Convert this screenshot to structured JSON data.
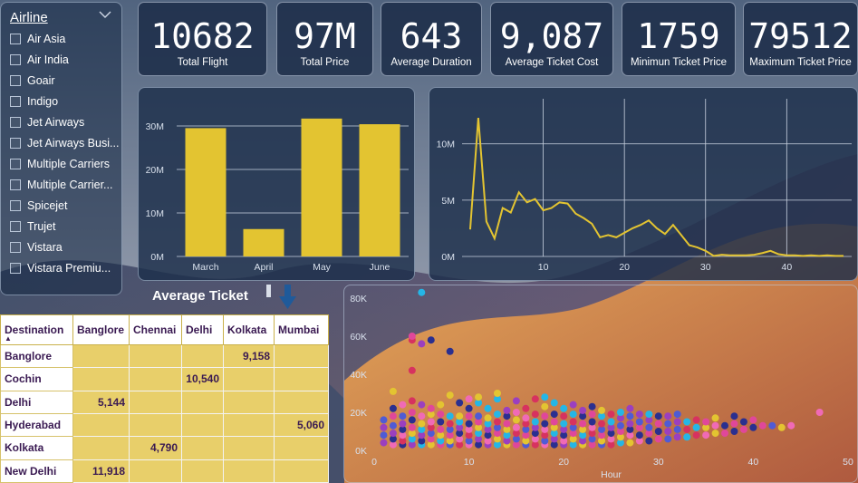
{
  "colors": {
    "bar": "#e3c431",
    "line": "#e3c431",
    "panel": "#1c2e4a",
    "scatter": [
      "#e0479a",
      "#f06ab6",
      "#25b6e6",
      "#4f5bd5",
      "#2a2f8f",
      "#e3c431",
      "#d7325f",
      "#9b3fbf"
    ]
  },
  "slicer": {
    "title": "Airline",
    "chevron_icon": "chevron-down-icon",
    "items": [
      "Air Asia",
      "Air India",
      "Goair",
      "Indigo",
      "Jet Airways",
      "Jet Airways Busi...",
      "Multiple Carriers",
      "Multiple Carrier...",
      "Spicejet",
      "Trujet",
      "Vistara",
      "Vistara Premiu..."
    ]
  },
  "kpis": [
    {
      "value": "10682",
      "label": "Total Flight"
    },
    {
      "value": "97M",
      "label": "Total Price"
    },
    {
      "value": "643",
      "label": "Average Duration"
    },
    {
      "value": "9,087",
      "label": "Average Ticket Cost"
    },
    {
      "value": "1759",
      "label": "Minimun Ticket Price"
    },
    {
      "value": "79512",
      "label": "Maximum Ticket Price"
    }
  ],
  "table": {
    "title": "Average Ticket",
    "sort_icon": "arrow-down-icon",
    "headers": [
      "Destination",
      "Banglore",
      "Chennai",
      "Delhi",
      "Kolkata",
      "Mumbai"
    ],
    "rows": [
      {
        "name": "Banglore",
        "cells": [
          "",
          "",
          "",
          "9,158",
          ""
        ]
      },
      {
        "name": "Cochin",
        "cells": [
          "",
          "",
          "10,540",
          "",
          ""
        ]
      },
      {
        "name": "Delhi",
        "cells": [
          "5,144",
          "",
          "",
          "",
          ""
        ]
      },
      {
        "name": "Hyderabad",
        "cells": [
          "",
          "",
          "",
          "",
          "5,060"
        ]
      },
      {
        "name": "Kolkata",
        "cells": [
          "",
          "4,790",
          "",
          "",
          ""
        ]
      },
      {
        "name": "New Delhi",
        "cells": [
          "11,918",
          "",
          "",
          "",
          ""
        ]
      }
    ]
  },
  "chart_data": [
    {
      "type": "bar",
      "categories": [
        "March",
        "April",
        "May",
        "June"
      ],
      "values": [
        29.5,
        6.3,
        31.7,
        30.4
      ],
      "ylim": [
        0,
        35
      ],
      "yticks": [
        "0M",
        "10M",
        "20M",
        "30M"
      ],
      "ytick_values": [
        0,
        10,
        20,
        30
      ],
      "grid": true
    },
    {
      "type": "line",
      "x": [
        1,
        2,
        3,
        4,
        5,
        6,
        7,
        8,
        9,
        10,
        11,
        12,
        13,
        14,
        15,
        16,
        17,
        18,
        19,
        20,
        21,
        22,
        23,
        24,
        25,
        26,
        27,
        28,
        29,
        30,
        31,
        32,
        33,
        34,
        35,
        36,
        37,
        38,
        39,
        40,
        41,
        42,
        43,
        44,
        45,
        46,
        47
      ],
      "values": [
        2.4,
        12.3,
        3.1,
        1.6,
        4.3,
        3.9,
        5.7,
        4.8,
        5.1,
        4.1,
        4.3,
        4.8,
        4.7,
        3.8,
        3.4,
        2.9,
        1.7,
        1.9,
        1.7,
        2.1,
        2.5,
        2.8,
        3.2,
        2.5,
        2.0,
        2.8,
        1.9,
        1.0,
        0.8,
        0.5,
        0.05,
        0.15,
        0.1,
        0.1,
        0.1,
        0.15,
        0.3,
        0.5,
        0.2,
        0.1,
        0.1,
        0.05,
        0.1,
        0.05,
        0.1,
        0.05,
        0.05
      ],
      "xlim": [
        0,
        48
      ],
      "ylim": [
        0,
        14
      ],
      "xticks": [
        "10",
        "20",
        "30",
        "40"
      ],
      "xtick_values": [
        10,
        20,
        30,
        40
      ],
      "yticks": [
        "0M",
        "5M",
        "10M"
      ],
      "ytick_values": [
        0,
        5,
        10
      ],
      "grid": true
    },
    {
      "type": "scatter",
      "xlabel": "Hour",
      "xlim": [
        0,
        50
      ],
      "ylim": [
        0,
        80
      ],
      "xticks": [
        "0",
        "10",
        "20",
        "30",
        "40",
        "50"
      ],
      "xtick_values": [
        0,
        10,
        20,
        30,
        40,
        50
      ],
      "yticks": [
        "0K",
        "20K",
        "40K",
        "60K",
        "80K"
      ],
      "ytick_values": [
        0,
        20,
        40,
        60,
        80
      ],
      "points": [
        [
          1,
          4
        ],
        [
          1,
          8
        ],
        [
          1,
          12
        ],
        [
          1,
          16
        ],
        [
          2,
          3
        ],
        [
          2,
          6
        ],
        [
          2,
          9
        ],
        [
          2,
          13
        ],
        [
          2,
          18
        ],
        [
          2,
          22
        ],
        [
          2,
          31
        ],
        [
          3,
          3
        ],
        [
          3,
          5
        ],
        [
          3,
          8
        ],
        [
          3,
          11
        ],
        [
          3,
          14
        ],
        [
          3,
          18
        ],
        [
          3,
          24
        ],
        [
          4,
          3
        ],
        [
          4,
          6
        ],
        [
          4,
          9
        ],
        [
          4,
          12
        ],
        [
          4,
          16
        ],
        [
          4,
          20
        ],
        [
          4,
          26
        ],
        [
          4,
          42
        ],
        [
          4,
          58
        ],
        [
          4,
          60
        ],
        [
          5,
          3
        ],
        [
          5,
          5
        ],
        [
          5,
          8
        ],
        [
          5,
          11
        ],
        [
          5,
          14
        ],
        [
          5,
          18
        ],
        [
          5,
          24
        ],
        [
          5,
          56
        ],
        [
          5,
          83
        ],
        [
          6,
          3
        ],
        [
          6,
          6
        ],
        [
          6,
          9
        ],
        [
          6,
          12
        ],
        [
          6,
          15
        ],
        [
          6,
          19
        ],
        [
          6,
          22
        ],
        [
          6,
          58
        ],
        [
          7,
          3
        ],
        [
          7,
          5
        ],
        [
          7,
          8
        ],
        [
          7,
          11
        ],
        [
          7,
          15
        ],
        [
          7,
          19
        ],
        [
          7,
          24
        ],
        [
          8,
          3
        ],
        [
          8,
          5
        ],
        [
          8,
          8
        ],
        [
          8,
          11
        ],
        [
          8,
          14
        ],
        [
          8,
          18
        ],
        [
          8,
          29
        ],
        [
          8,
          52
        ],
        [
          9,
          3
        ],
        [
          9,
          6
        ],
        [
          9,
          9
        ],
        [
          9,
          12
        ],
        [
          9,
          15
        ],
        [
          9,
          18
        ],
        [
          9,
          25
        ],
        [
          10,
          3
        ],
        [
          10,
          5
        ],
        [
          10,
          8
        ],
        [
          10,
          11
        ],
        [
          10,
          14
        ],
        [
          10,
          18
        ],
        [
          10,
          22
        ],
        [
          10,
          27
        ],
        [
          11,
          3
        ],
        [
          11,
          6
        ],
        [
          11,
          9
        ],
        [
          11,
          12
        ],
        [
          11,
          15
        ],
        [
          11,
          18
        ],
        [
          11,
          25
        ],
        [
          11,
          28
        ],
        [
          12,
          3
        ],
        [
          12,
          5
        ],
        [
          12,
          8
        ],
        [
          12,
          11
        ],
        [
          12,
          14
        ],
        [
          12,
          17
        ],
        [
          12,
          22
        ],
        [
          13,
          3
        ],
        [
          13,
          6
        ],
        [
          13,
          9
        ],
        [
          13,
          12
        ],
        [
          13,
          15
        ],
        [
          13,
          19
        ],
        [
          13,
          27
        ],
        [
          13,
          30
        ],
        [
          14,
          3
        ],
        [
          14,
          5
        ],
        [
          14,
          8
        ],
        [
          14,
          11
        ],
        [
          14,
          14
        ],
        [
          14,
          18
        ],
        [
          14,
          21
        ],
        [
          15,
          3
        ],
        [
          15,
          6
        ],
        [
          15,
          9
        ],
        [
          15,
          12
        ],
        [
          15,
          16
        ],
        [
          15,
          20
        ],
        [
          15,
          26
        ],
        [
          16,
          3
        ],
        [
          16,
          5
        ],
        [
          16,
          8
        ],
        [
          16,
          11
        ],
        [
          16,
          14
        ],
        [
          16,
          17
        ],
        [
          16,
          22
        ],
        [
          17,
          3
        ],
        [
          17,
          6
        ],
        [
          17,
          9
        ],
        [
          17,
          12
        ],
        [
          17,
          15
        ],
        [
          17,
          19
        ],
        [
          17,
          27
        ],
        [
          18,
          3
        ],
        [
          18,
          5
        ],
        [
          18,
          8
        ],
        [
          18,
          11
        ],
        [
          18,
          14
        ],
        [
          18,
          18
        ],
        [
          18,
          23
        ],
        [
          18,
          28
        ],
        [
          19,
          3
        ],
        [
          19,
          6
        ],
        [
          19,
          9
        ],
        [
          19,
          12
        ],
        [
          19,
          15
        ],
        [
          19,
          19
        ],
        [
          19,
          25
        ],
        [
          20,
          3
        ],
        [
          20,
          5
        ],
        [
          20,
          8
        ],
        [
          20,
          11
        ],
        [
          20,
          14
        ],
        [
          20,
          18
        ],
        [
          20,
          22
        ],
        [
          21,
          3
        ],
        [
          21,
          6
        ],
        [
          21,
          9
        ],
        [
          21,
          12
        ],
        [
          21,
          15
        ],
        [
          21,
          19
        ],
        [
          21,
          24
        ],
        [
          22,
          3
        ],
        [
          22,
          5
        ],
        [
          22,
          8
        ],
        [
          22,
          11
        ],
        [
          22,
          14
        ],
        [
          22,
          18
        ],
        [
          22,
          21
        ],
        [
          23,
          3
        ],
        [
          23,
          6
        ],
        [
          23,
          9
        ],
        [
          23,
          12
        ],
        [
          23,
          15
        ],
        [
          23,
          19
        ],
        [
          23,
          23
        ],
        [
          24,
          3
        ],
        [
          24,
          5
        ],
        [
          24,
          8
        ],
        [
          24,
          11
        ],
        [
          24,
          14
        ],
        [
          24,
          18
        ],
        [
          24,
          21
        ],
        [
          25,
          3
        ],
        [
          25,
          6
        ],
        [
          25,
          9
        ],
        [
          25,
          12
        ],
        [
          25,
          15
        ],
        [
          25,
          19
        ],
        [
          26,
          4
        ],
        [
          26,
          7
        ],
        [
          26,
          10
        ],
        [
          26,
          13
        ],
        [
          26,
          17
        ],
        [
          26,
          20
        ],
        [
          27,
          4
        ],
        [
          27,
          8
        ],
        [
          27,
          11
        ],
        [
          27,
          14
        ],
        [
          27,
          18
        ],
        [
          27,
          22
        ],
        [
          28,
          5
        ],
        [
          28,
          8
        ],
        [
          28,
          12
        ],
        [
          28,
          15
        ],
        [
          28,
          19
        ],
        [
          29,
          5
        ],
        [
          29,
          9
        ],
        [
          29,
          12
        ],
        [
          29,
          16
        ],
        [
          29,
          19
        ],
        [
          30,
          6
        ],
        [
          30,
          10
        ],
        [
          30,
          14
        ],
        [
          30,
          18
        ],
        [
          31,
          6
        ],
        [
          31,
          10
        ],
        [
          31,
          14
        ],
        [
          31,
          18
        ],
        [
          32,
          7
        ],
        [
          32,
          11
        ],
        [
          32,
          15
        ],
        [
          32,
          19
        ],
        [
          33,
          7
        ],
        [
          33,
          11
        ],
        [
          33,
          15
        ],
        [
          34,
          8
        ],
        [
          34,
          12
        ],
        [
          34,
          16
        ],
        [
          35,
          8
        ],
        [
          35,
          12
        ],
        [
          35,
          15
        ],
        [
          36,
          9
        ],
        [
          36,
          13
        ],
        [
          36,
          17
        ],
        [
          37,
          9
        ],
        [
          37,
          13
        ],
        [
          38,
          10
        ],
        [
          38,
          14
        ],
        [
          38,
          18
        ],
        [
          39,
          11
        ],
        [
          39,
          15
        ],
        [
          40,
          12
        ],
        [
          40,
          16
        ],
        [
          41,
          13
        ],
        [
          42,
          13
        ],
        [
          43,
          12
        ],
        [
          44,
          13
        ],
        [
          47,
          20
        ]
      ]
    }
  ]
}
